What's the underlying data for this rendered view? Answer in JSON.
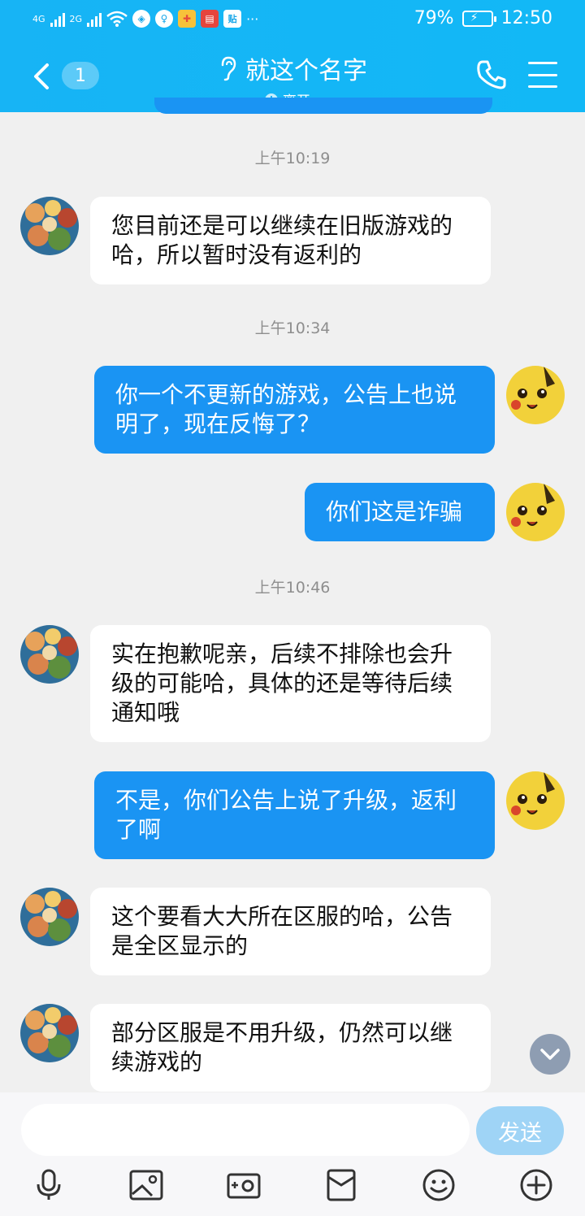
{
  "status_bar": {
    "network_1": "4G",
    "network_2": "2G",
    "battery_percent": "79%",
    "time": "12:50",
    "more": "···",
    "tieba_icon_label": "贴"
  },
  "header": {
    "unread_count": "1",
    "title": "就这个名字",
    "presence": "离开 ›",
    "accent_color": "#17b4f5"
  },
  "messages": [
    {
      "type": "time",
      "text": "上午10:19"
    },
    {
      "type": "in",
      "text": "您目前还是可以继续在旧版游戏的哈，所以暂时没有返利的"
    },
    {
      "type": "time",
      "text": "上午10:34"
    },
    {
      "type": "out",
      "text": "你一个不更新的游戏，公告上也说明了，现在反悔了？"
    },
    {
      "type": "out",
      "text": "你们这是诈骗"
    },
    {
      "type": "time",
      "text": "上午10:46"
    },
    {
      "type": "in",
      "text": "实在抱歉呢亲，后续不排除也会升级的可能哈，具体的还是等待后续通知哦"
    },
    {
      "type": "out",
      "text": "不是，你们公告上说了升级，返利了啊"
    },
    {
      "type": "in",
      "text": "这个要看大大所在区服的哈，公告是全区显示的"
    },
    {
      "type": "in",
      "text": "部分区服是不用升级，仍然可以继续游戏的"
    }
  ],
  "input": {
    "value": "",
    "placeholder": "",
    "send_label": "发送"
  },
  "toolbar": [
    "microphone-icon",
    "image-icon",
    "camera-icon",
    "red-packet-icon",
    "emoji-icon",
    "plus-icon"
  ]
}
